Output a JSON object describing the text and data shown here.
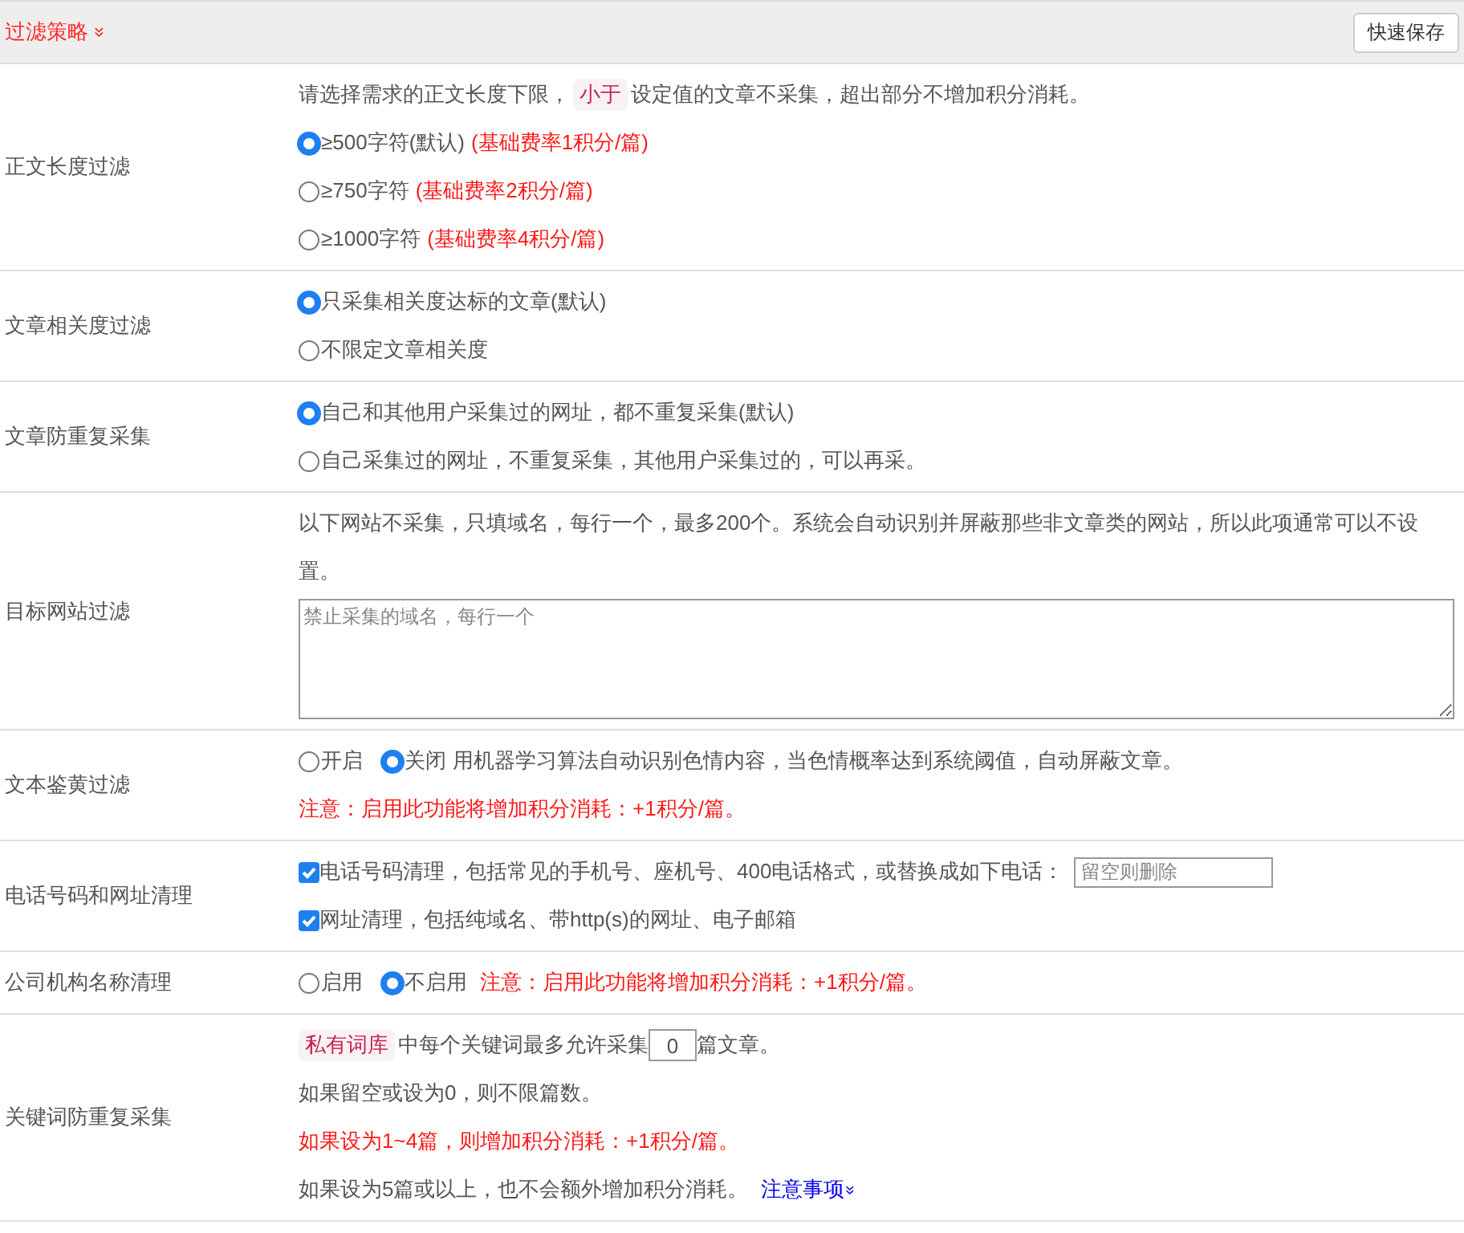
{
  "header": {
    "title": "过滤策略",
    "expand_icon": "»",
    "save_button": "快速保存"
  },
  "sections": [
    {
      "label": "正文长度过滤",
      "lines": [
        {
          "kind": "tagged",
          "before": "请选择需求的正文长度下限，",
          "tag": "小于",
          "after": "设定值的文章不采集，超出部分不增加积分消耗。"
        },
        {
          "kind": "radio",
          "label": "≥500字符(默认)",
          "note": "(基础费率1积分/篇)",
          "selected": true
        },
        {
          "kind": "radio",
          "label": "≥750字符",
          "note": "(基础费率2积分/篇)",
          "selected": false
        },
        {
          "kind": "radio",
          "label": "≥1000字符",
          "note": "(基础费率4积分/篇)",
          "selected": false
        }
      ]
    },
    {
      "label": "文章相关度过滤",
      "lines": [
        {
          "kind": "radio",
          "label": "只采集相关度达标的文章(默认)",
          "selected": true
        },
        {
          "kind": "radio",
          "label": "不限定文章相关度",
          "selected": false
        }
      ]
    },
    {
      "label": "文章防重复采集",
      "lines": [
        {
          "kind": "radio",
          "label": "自己和其他用户采集过的网址，都不重复采集(默认)",
          "selected": true
        },
        {
          "kind": "radio",
          "label": "自己采集过的网址，不重复采集，其他用户采集过的，可以再采。",
          "selected": false
        }
      ]
    },
    {
      "label": "目标网站过滤",
      "lines": [
        {
          "kind": "text",
          "text": "以下网站不采集，只填域名，每行一个，最多200个。系统会自动识别并屏蔽那些非文章类的网站，所以此项通常可以不设置。"
        },
        {
          "kind": "textarea",
          "placeholder": "禁止采集的域名，每行一个"
        }
      ]
    },
    {
      "label": "文本鉴黄过滤",
      "lines": [
        {
          "kind": "radios",
          "options": [
            {
              "label": "开启",
              "selected": false
            },
            {
              "label": "关闭",
              "selected": true
            }
          ],
          "text": "用机器学习算法自动识别色情内容，当色情概率达到系统阈值，自动屏蔽文章。"
        },
        {
          "kind": "warning",
          "text": "注意：启用此功能将增加积分消耗：+1积分/篇。"
        }
      ]
    },
    {
      "label": "电话号码和网址清理",
      "lines": [
        {
          "kind": "checkbox",
          "label": "电话号码清理，包括常见的手机号、座机号、400电话格式，或替换成如下电话：",
          "checked": true,
          "placeholder": "留空则删除"
        },
        {
          "kind": "checkbox",
          "label": "网址清理，包括纯域名、带http(s)的网址、电子邮箱",
          "checked": true
        }
      ]
    },
    {
      "label": "公司机构名称清理",
      "lines": [
        {
          "kind": "radios",
          "options": [
            {
              "label": "启用",
              "selected": false
            },
            {
              "label": "不启用",
              "selected": true
            }
          ],
          "warning": "注意：启用此功能将增加积分消耗：+1积分/篇。"
        }
      ]
    },
    {
      "label": "关键词防重复采集",
      "lines": [
        {
          "kind": "number",
          "tag": "私有词库",
          "before": "中每个关键词最多允许采集",
          "value": "0",
          "after": "篇文章。"
        },
        {
          "kind": "text",
          "text": "如果留空或设为0，则不限篇数。"
        },
        {
          "kind": "warning",
          "text": "如果设为1~4篇，则增加积分消耗：+1积分/篇。"
        },
        {
          "kind": "link_text",
          "text": "如果设为5篇或以上，也不会额外增加积分消耗。",
          "link": "注意事项",
          "link_icon": "»"
        }
      ]
    }
  ]
}
